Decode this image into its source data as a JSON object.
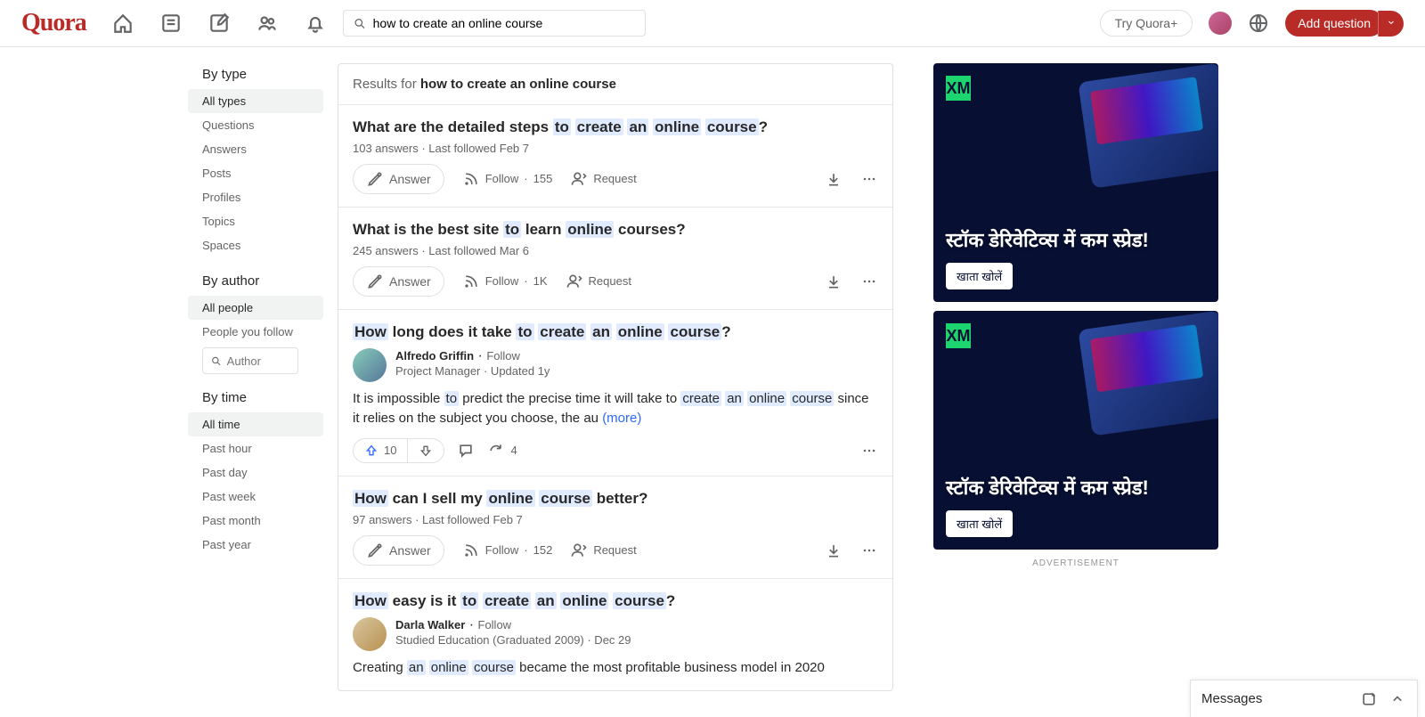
{
  "header": {
    "logo": "Quora",
    "search_value": "how to create an online course",
    "try_plus": "Try Quora+",
    "add_question": "Add question"
  },
  "sidebar": {
    "by_type": {
      "title": "By type",
      "items": [
        "All types",
        "Questions",
        "Answers",
        "Posts",
        "Profiles",
        "Topics",
        "Spaces"
      ],
      "active_index": 0
    },
    "by_author": {
      "title": "By author",
      "items": [
        "All people",
        "People you follow"
      ],
      "active_index": 0,
      "search_placeholder": "Author"
    },
    "by_time": {
      "title": "By time",
      "items": [
        "All time",
        "Past hour",
        "Past day",
        "Past week",
        "Past month",
        "Past year"
      ],
      "active_index": 0
    }
  },
  "results": {
    "results_for_prefix": "Results for",
    "query": "how to create an online course",
    "answer_label": "Answer",
    "follow_label": "Follow",
    "request_label": "Request",
    "more_label": "(more)",
    "items": [
      {
        "title_parts": [
          "What are the detailed steps ",
          "to",
          " ",
          "create",
          " ",
          "an",
          " ",
          "online",
          " ",
          "course",
          "?"
        ],
        "meta": "103 answers · Last followed Feb 7",
        "follow_count": "155"
      },
      {
        "title_parts": [
          "What is the best site ",
          "to",
          " learn ",
          "online",
          " courses?"
        ],
        "meta": "245 answers · Last followed Mar 6",
        "follow_count": "1K"
      },
      {
        "title_parts": [
          "How",
          " long does it take ",
          "to",
          " ",
          "create",
          " ",
          "an",
          " ",
          "online",
          " ",
          "course",
          "?"
        ],
        "author_name": "Alfredo Griffin",
        "author_sub": "Project Manager · Updated 1y",
        "follow_link": "Follow",
        "body_parts": [
          "It is impossible ",
          "to",
          " predict the precise time it will take to ",
          "create",
          " ",
          "an",
          " ",
          "online",
          " ",
          "course",
          " since it relies on the subject you choose, the au ",
          "(more)"
        ],
        "upvotes": "10",
        "shares": "4"
      },
      {
        "title_parts": [
          "How",
          " can I sell my ",
          "online",
          " ",
          "course",
          " better?"
        ],
        "meta": "97 answers · Last followed Feb 7",
        "follow_count": "152"
      },
      {
        "title_parts": [
          "How",
          " easy is it ",
          "to",
          " ",
          "create",
          " ",
          "an",
          " ",
          "online",
          " ",
          "course",
          "?"
        ],
        "author_name": "Darla Walker",
        "author_sub": "Studied Education (Graduated 2009) · Dec 29",
        "follow_link": "Follow",
        "body_parts": [
          "Creating ",
          "an",
          " ",
          "online",
          " ",
          "course",
          " became the most profitable business model in 2020"
        ]
      }
    ]
  },
  "ads": {
    "brand": "XM",
    "headline": "स्टॉक डेरिवेटिव्स में कम स्प्रेड!",
    "cta": "खाता खोलें",
    "label": "ADVERTISEMENT"
  },
  "messages": {
    "label": "Messages"
  }
}
